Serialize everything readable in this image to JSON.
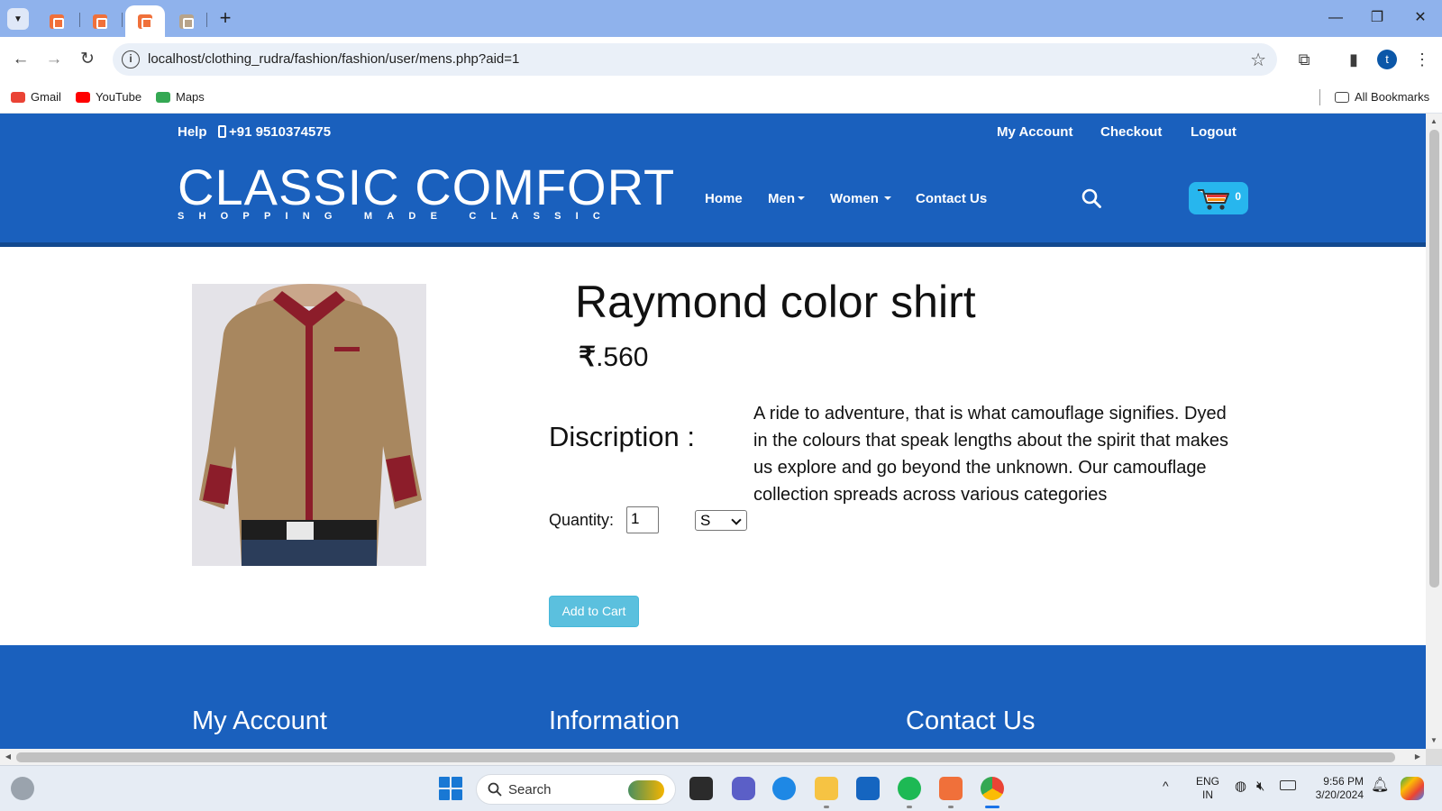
{
  "browser": {
    "url": "localhost/clothing_rudra/fashion/fashion/user/mens.php?aid=1",
    "profile_initial": "t",
    "bookmarks": [
      {
        "label": "Gmail",
        "color": "#ea4335"
      },
      {
        "label": "YouTube",
        "color": "#ff0000"
      },
      {
        "label": "Maps",
        "color": "#34a853"
      }
    ],
    "all_bookmarks_label": "All Bookmarks"
  },
  "site": {
    "topbar": {
      "help": "Help",
      "phone": "+91 9510374575",
      "links": [
        "My Account",
        "Checkout",
        "Logout"
      ]
    },
    "logo": "CLASSIC COMFORT",
    "tagline": "SHOPPING MADE CLASSIC",
    "nav": [
      "Home",
      "Men",
      "Women",
      "Contact Us"
    ],
    "cart_count": "0",
    "colors": {
      "brand_blue": "#1a60bd",
      "cart_blue": "#27b6ee",
      "button_info": "#5bc0de"
    }
  },
  "product": {
    "title": "Raymond color shirt",
    "price_symbol": "₹",
    "price": ".560",
    "description_label": "Discription :",
    "description": "A ride to adventure, that is what camouflage signifies. Dyed in the colours that speak lengths about the spirit that makes us explore and go beyond the unknown. Our camouflage collection spreads across various categories",
    "quantity_label": "Quantity:",
    "quantity": "1",
    "size": "S",
    "add_to_cart": "Add to Cart"
  },
  "footer": {
    "headings": [
      "My Account",
      "Information",
      "Contact Us"
    ]
  },
  "taskbar": {
    "search_placeholder": "Search",
    "lang_top": "ENG",
    "lang_bottom": "IN",
    "time": "9:56 PM",
    "date": "3/20/2024"
  }
}
